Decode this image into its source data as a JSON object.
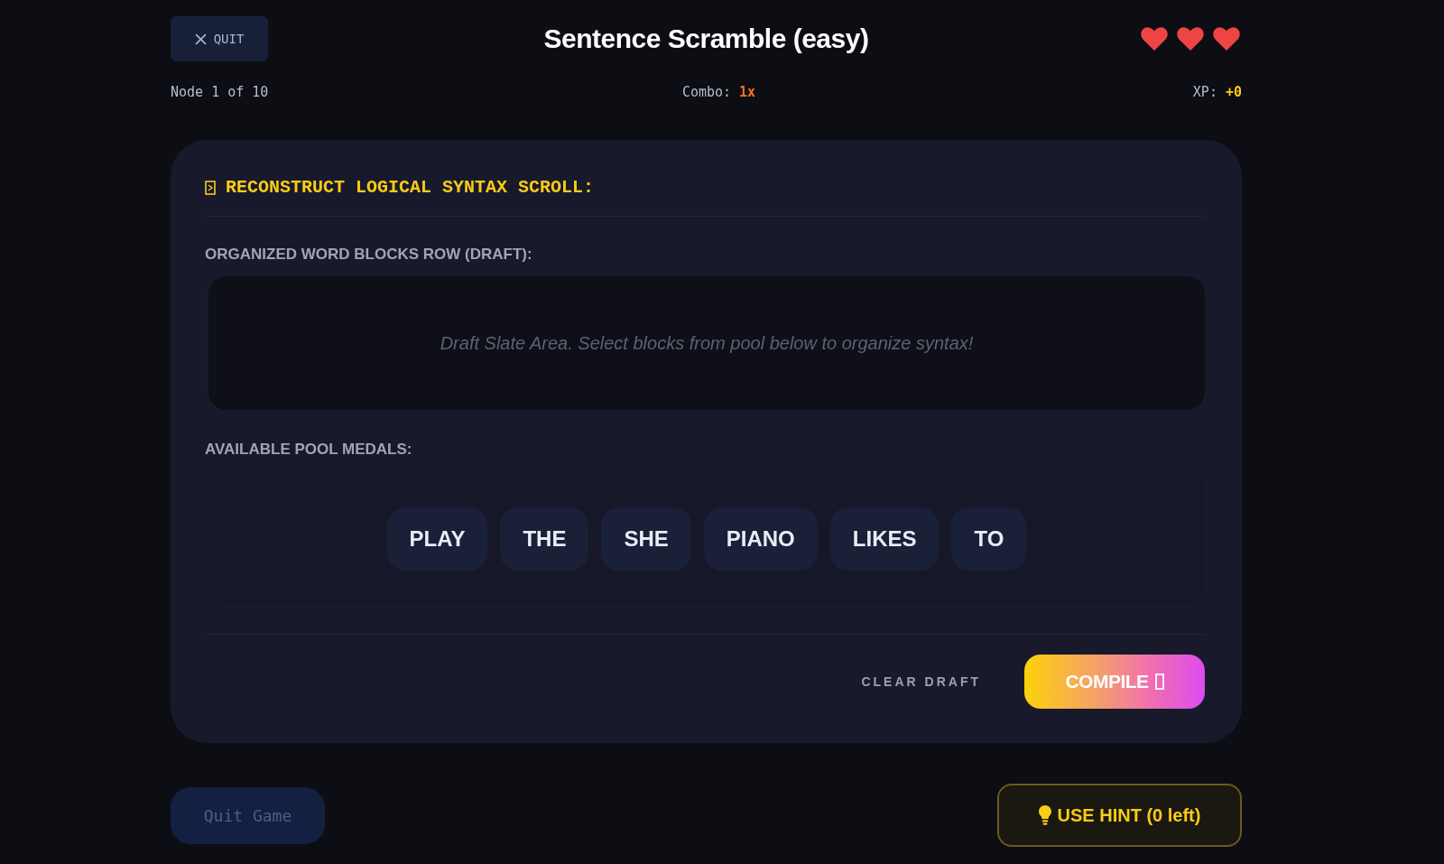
{
  "header": {
    "quit_button": "QUIT",
    "title": "Sentence Scramble (easy)",
    "lives": [
      {
        "filled": true
      },
      {
        "filled": true
      },
      {
        "filled": true
      }
    ]
  },
  "status": {
    "progress": "Node 1 of 10",
    "combo_label": "Combo:",
    "combo_value": "1x",
    "xp_label": "XP:",
    "xp_value": "+0"
  },
  "card": {
    "prompt": "RECONSTRUCT LOGICAL SYNTAX SCROLL:",
    "draft_label": "ORGANIZED WORD BLOCKS ROW (DRAFT):",
    "draft_empty_text": "Draft Slate Area. Select blocks from pool below to organize syntax!",
    "pool_label": "AVAILABLE POOL MEDALS:",
    "pool_words": [
      {
        "word": "PLAY"
      },
      {
        "word": "THE"
      },
      {
        "word": "SHE"
      },
      {
        "word": "PIANO"
      },
      {
        "word": "LIKES"
      },
      {
        "word": "TO"
      }
    ],
    "clear_button": "CLEAR DRAFT",
    "compile_button": "COMPILE"
  },
  "footer": {
    "quit_game_button": "Quit Game",
    "hint_button": "USE HINT (0 left)"
  }
}
